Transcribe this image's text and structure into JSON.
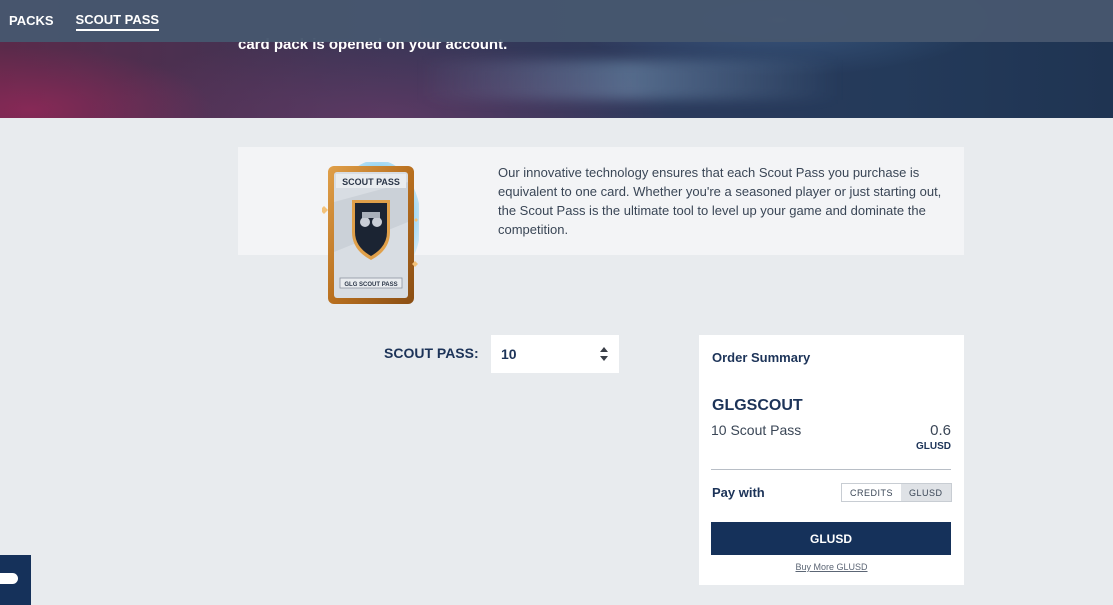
{
  "nav": {
    "items": [
      "PACKS",
      "SCOUT PASS"
    ]
  },
  "hero": {
    "text": "card pack is opened on your account."
  },
  "info": {
    "description": "Our innovative technology ensures that each Scout Pass you purchase is equivalent to one card. Whether you're a seasoned player or just starting out, the Scout Pass is the ultimate tool to level up your game and dominate the competition.",
    "card_title": "SCOUT PASS",
    "card_footer": "GLG SCOUT PASS"
  },
  "quantity": {
    "label": "SCOUT PASS:",
    "value": "10"
  },
  "order_summary": {
    "title": "Order Summary",
    "product": "GLGSCOUT",
    "line_item": "10 Scout Pass",
    "price": "0.6",
    "currency": "GLUSD",
    "pay_with_label": "Pay with",
    "pay_options": [
      "CREDITS",
      "GLUSD"
    ],
    "selected_option": "GLUSD",
    "pay_button": "GLUSD",
    "buy_more": "Buy More GLUSD"
  },
  "colors": {
    "brand_navy": "#15315a",
    "nav_bg": "#46576e",
    "page_bg": "#e8ebee"
  }
}
